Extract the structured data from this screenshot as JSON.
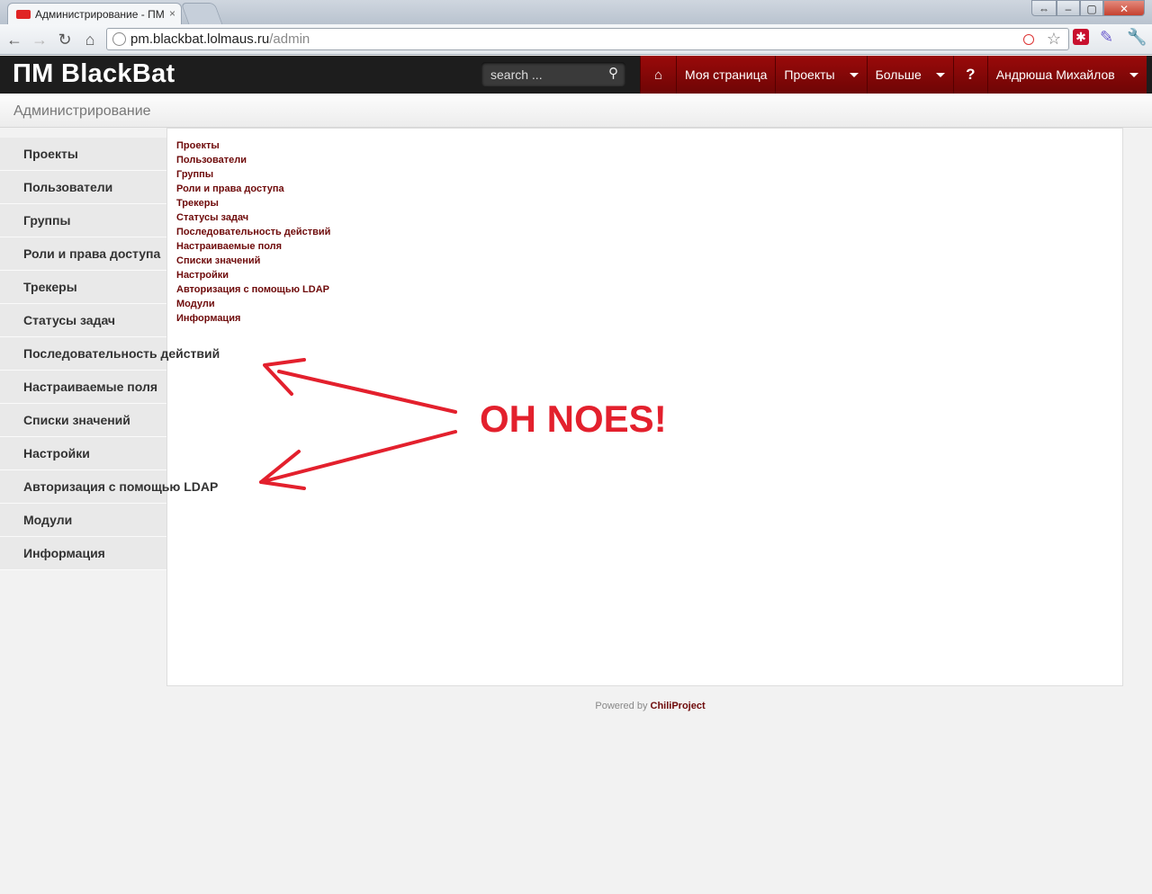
{
  "browser": {
    "tab_title": "Администрирование - ПМ",
    "tab_close": "×",
    "url_host": "pm.blackbat.lolmaus.ru",
    "url_path": "/admin",
    "window_buttons": {
      "restore": "⇔",
      "minimize": "–",
      "maximize": "▢",
      "close": "✕"
    },
    "nav_icons": {
      "back": "←",
      "forward": "→",
      "reload": "↻",
      "home": "⌂",
      "star": "☆",
      "ext1": "✱",
      "ext2": "✎",
      "wrench": "🔧"
    }
  },
  "header": {
    "site_title": "ПМ BlackBat",
    "search_placeholder": "search ...",
    "search_icon": "⚲",
    "nav": {
      "home_icon": "⌂",
      "my_page": "Моя страница",
      "projects": "Проекты",
      "more": "Больше",
      "help": "?",
      "user": "Андрюша Михайлов"
    }
  },
  "subheader": {
    "title": "Администрирование"
  },
  "sidebar": {
    "items": [
      "Проекты",
      "Пользователи",
      "Группы",
      "Роли и права доступа",
      "Трекеры",
      "Статусы задач",
      "Последовательность действий",
      "Настраиваемые поля",
      "Списки значений",
      "Настройки",
      "Авторизация с помощью LDAP",
      "Модули",
      "Информация"
    ]
  },
  "content": {
    "links": [
      "Проекты",
      "Пользователи",
      "Группы",
      "Роли и права доступа",
      "Трекеры",
      "Статусы задач",
      "Последовательность действий",
      "Настраиваемые поля",
      "Списки значений",
      "Настройки",
      "Авторизация с помощью LDAP",
      "Модули",
      "Информация"
    ]
  },
  "annotation": {
    "text": "OH NOES!",
    "color": "#e3202d"
  },
  "footer": {
    "prefix": "Powered by",
    "brand": "ChiliProject"
  },
  "colors": {
    "accent": "#8b0a0a",
    "header_bg": "#1d1d1d",
    "link": "#6e0a0a"
  }
}
